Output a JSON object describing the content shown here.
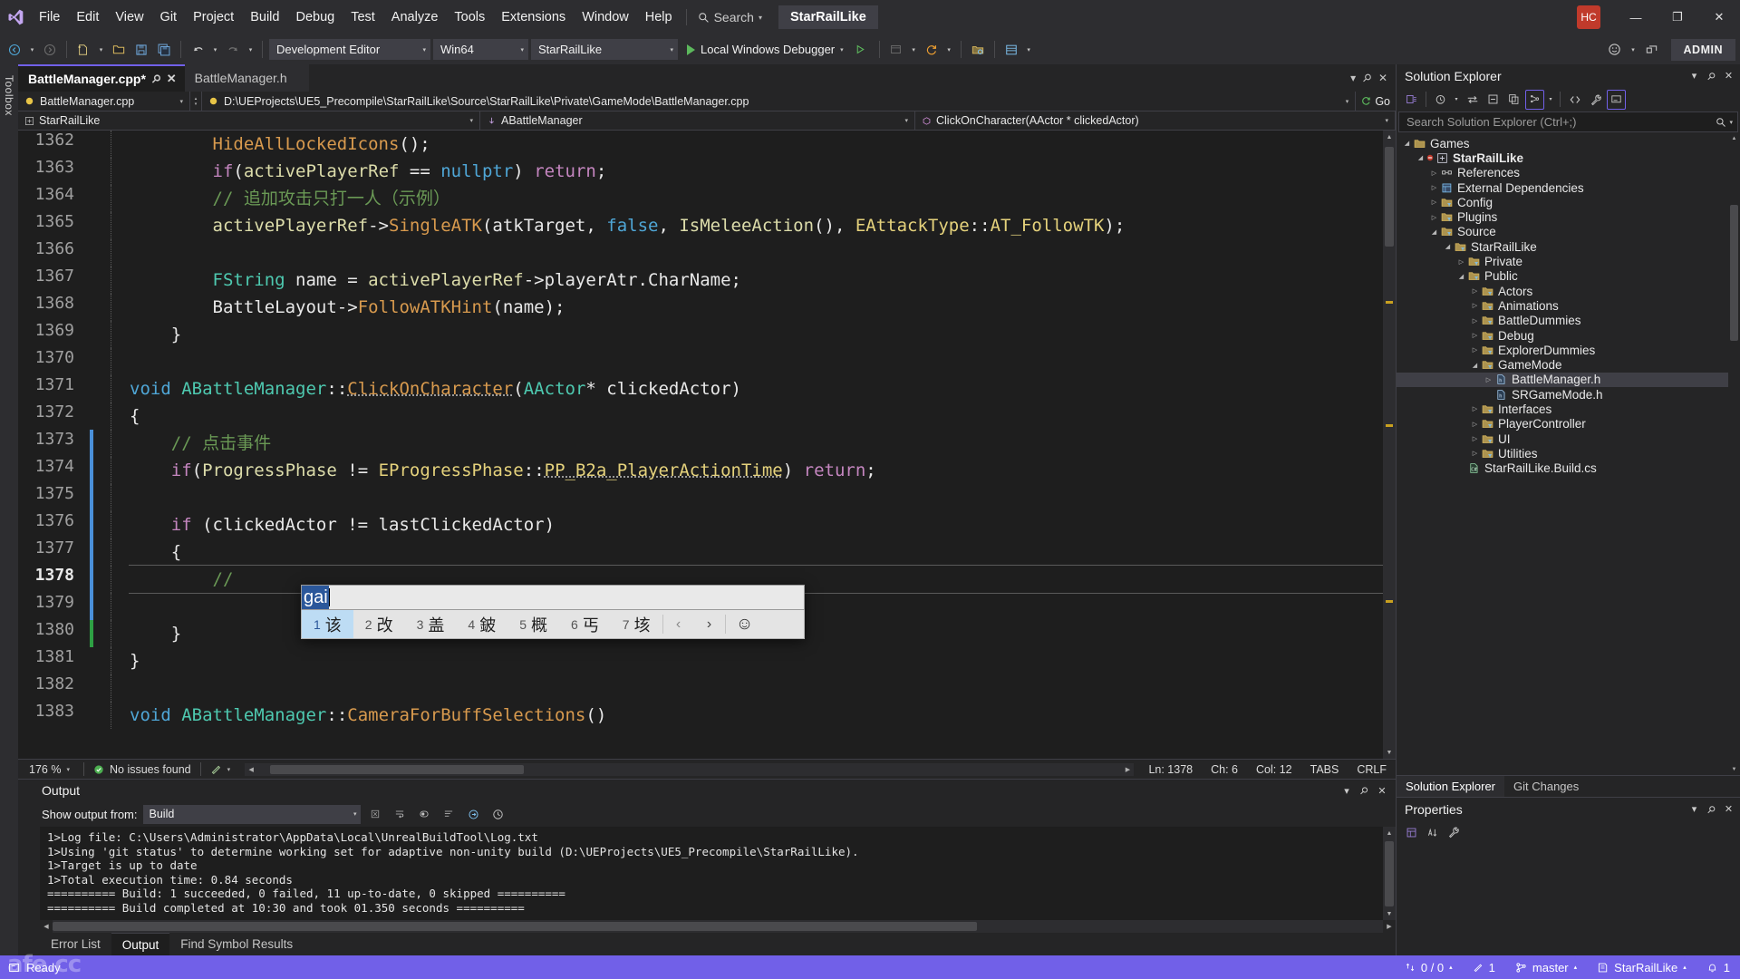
{
  "titlebar": {
    "logo_icon": "visual-studio-logo-icon",
    "menus": [
      "File",
      "Edit",
      "View",
      "Git",
      "Project",
      "Build",
      "Debug",
      "Test",
      "Analyze",
      "Tools",
      "Extensions",
      "Window",
      "Help"
    ],
    "search": {
      "label": "Search",
      "icon": "search-icon"
    },
    "solution_chip": "StarRailLike",
    "account_initials": "HC",
    "window_buttons": {
      "minimize": "—",
      "maximize": "❐",
      "close": "✕"
    }
  },
  "toolbar": {
    "back_icon": "navigate-back-icon",
    "forward_icon": "navigate-forward-icon",
    "new_item_icon": "new-item-icon",
    "open_icon": "open-file-icon",
    "save_icon": "save-icon",
    "save_all_icon": "save-all-icon",
    "undo_icon": "undo-icon",
    "redo_icon": "redo-icon",
    "config_combo": "Development Editor",
    "platform_combo": "Win64",
    "startup_combo": "StarRailLike",
    "run_label": "Local Windows Debugger",
    "run_icon": "play-icon",
    "attach_icon": "attach-process-icon",
    "layout_icon": "window-layout-icon",
    "refresh_icon": "hot-reload-icon",
    "folder_icon": "folder-icon",
    "panel_icon": "panel-icon",
    "feedback_icon": "feedback-icon",
    "live_share_icon": "live-share-icon",
    "admin_chip": "ADMIN"
  },
  "toolbox_strip": {
    "label": "Toolbox"
  },
  "editor": {
    "tabs": [
      {
        "label": "BattleManager.cpp*",
        "active": true,
        "pin_icon": "pin-icon",
        "close_icon": "close-icon"
      },
      {
        "label": "BattleManager.h",
        "active": false
      }
    ],
    "nav": {
      "file_combo": "BattleManager.cpp",
      "file_icon": "cpp-file-icon",
      "path": "D:\\UEProjects\\UE5_Precompile\\StarRailLike\\Source\\StarRailLike\\Private\\GameMode\\BattleManager.cpp",
      "path_icon": "cpp-file-icon",
      "go_label": "Go",
      "go_icon": "go-arrow-icon"
    },
    "breadcrumb": [
      {
        "label": "StarRailLike",
        "icon": "project-icon"
      },
      {
        "label": "ABattleManager",
        "icon": "class-icon"
      },
      {
        "label": "ClickOnCharacter(AActor * clickedActor)",
        "icon": "method-icon"
      }
    ],
    "lines": [
      {
        "no": "1362",
        "change": "",
        "tokens": [
          {
            "t": "        ",
            "c": "pl"
          },
          {
            "t": "HideAllLockedIcons",
            "c": "fn"
          },
          {
            "t": "();",
            "c": "pl"
          }
        ]
      },
      {
        "no": "1363",
        "change": "",
        "tokens": [
          {
            "t": "        ",
            "c": "pl"
          },
          {
            "t": "if",
            "c": "k"
          },
          {
            "t": "(",
            "c": "pl"
          },
          {
            "t": "activePlayerRef",
            "c": "id"
          },
          {
            "t": " == ",
            "c": "pl"
          },
          {
            "t": "nullptr",
            "c": "kb"
          },
          {
            "t": ") ",
            "c": "pl"
          },
          {
            "t": "return",
            "c": "k"
          },
          {
            "t": ";",
            "c": "pl"
          }
        ]
      },
      {
        "no": "1364",
        "change": "",
        "tokens": [
          {
            "t": "        ",
            "c": "pl"
          },
          {
            "t": "// 追加攻击只打一人（示例）",
            "c": "cm"
          }
        ]
      },
      {
        "no": "1365",
        "change": "",
        "tokens": [
          {
            "t": "        ",
            "c": "pl"
          },
          {
            "t": "activePlayerRef",
            "c": "id"
          },
          {
            "t": "->",
            "c": "pl"
          },
          {
            "t": "SingleATK",
            "c": "fn"
          },
          {
            "t": "(",
            "c": "pl"
          },
          {
            "t": "atkTarget",
            "c": "pl"
          },
          {
            "t": ", ",
            "c": "pl"
          },
          {
            "t": "false",
            "c": "kb"
          },
          {
            "t": ", ",
            "c": "pl"
          },
          {
            "t": "IsMeleeAction",
            "c": "id"
          },
          {
            "t": "(), ",
            "c": "pl"
          },
          {
            "t": "EAttackType",
            "c": "en"
          },
          {
            "t": "::",
            "c": "pl"
          },
          {
            "t": "AT_FollowTK",
            "c": "en"
          },
          {
            "t": ");",
            "c": "pl"
          }
        ]
      },
      {
        "no": "1366",
        "change": "",
        "tokens": [
          {
            "t": "",
            "c": "pl"
          }
        ]
      },
      {
        "no": "1367",
        "change": "",
        "tokens": [
          {
            "t": "        ",
            "c": "pl"
          },
          {
            "t": "FString",
            "c": "cls"
          },
          {
            "t": " name = ",
            "c": "pl"
          },
          {
            "t": "activePlayerRef",
            "c": "id"
          },
          {
            "t": "->",
            "c": "pl"
          },
          {
            "t": "playerAtr",
            "c": "pl"
          },
          {
            "t": ".",
            "c": "pl"
          },
          {
            "t": "CharName",
            "c": "pl"
          },
          {
            "t": ";",
            "c": "pl"
          }
        ]
      },
      {
        "no": "1368",
        "change": "",
        "tokens": [
          {
            "t": "        ",
            "c": "pl"
          },
          {
            "t": "BattleLayout",
            "c": "pl"
          },
          {
            "t": "->",
            "c": "pl"
          },
          {
            "t": "FollowATKHint",
            "c": "fn"
          },
          {
            "t": "(name);",
            "c": "pl"
          }
        ]
      },
      {
        "no": "1369",
        "change": "",
        "tokens": [
          {
            "t": "    }",
            "c": "pl"
          }
        ]
      },
      {
        "no": "1370",
        "change": "",
        "tokens": [
          {
            "t": "",
            "c": "pl"
          }
        ]
      },
      {
        "no": "1371",
        "change": "",
        "tokens": [
          {
            "t": "void",
            "c": "kb"
          },
          {
            "t": " ",
            "c": "pl"
          },
          {
            "t": "ABattleManager",
            "c": "cls"
          },
          {
            "t": "::",
            "c": "pl"
          },
          {
            "t": "ClickOnCharacter",
            "c": "fn-und"
          },
          {
            "t": "(",
            "c": "pl"
          },
          {
            "t": "AActor",
            "c": "cls"
          },
          {
            "t": "* clickedActor)",
            "c": "pl"
          }
        ]
      },
      {
        "no": "1372",
        "change": "",
        "tokens": [
          {
            "t": "{",
            "c": "pl"
          }
        ]
      },
      {
        "no": "1373",
        "change": "edit",
        "tokens": [
          {
            "t": "    ",
            "c": "pl"
          },
          {
            "t": "// 点击事件",
            "c": "cm"
          }
        ]
      },
      {
        "no": "1374",
        "change": "edit",
        "tokens": [
          {
            "t": "    ",
            "c": "pl"
          },
          {
            "t": "if",
            "c": "k"
          },
          {
            "t": "(",
            "c": "pl"
          },
          {
            "t": "ProgressPhase",
            "c": "id"
          },
          {
            "t": " != ",
            "c": "pl"
          },
          {
            "t": "EProgressPhase",
            "c": "en"
          },
          {
            "t": "::",
            "c": "pl"
          },
          {
            "t": "PP_B2a_PlayerActionTime",
            "c": "en-und"
          },
          {
            "t": ") ",
            "c": "pl"
          },
          {
            "t": "return",
            "c": "k"
          },
          {
            "t": ";",
            "c": "pl"
          }
        ]
      },
      {
        "no": "1375",
        "change": "edit",
        "tokens": [
          {
            "t": "",
            "c": "pl"
          }
        ]
      },
      {
        "no": "1376",
        "change": "edit",
        "tokens": [
          {
            "t": "    ",
            "c": "pl"
          },
          {
            "t": "if",
            "c": "k"
          },
          {
            "t": " (clickedActor != lastClickedActor)",
            "c": "pl"
          }
        ]
      },
      {
        "no": "1377",
        "change": "edit",
        "tokens": [
          {
            "t": "    {",
            "c": "pl"
          }
        ]
      },
      {
        "no": "1378",
        "change": "edit",
        "current": true,
        "tokens": [
          {
            "t": "        ",
            "c": "pl"
          },
          {
            "t": "//  ",
            "c": "cm"
          }
        ]
      },
      {
        "no": "1379",
        "change": "edit",
        "tokens": [
          {
            "t": "",
            "c": "pl"
          }
        ]
      },
      {
        "no": "1380",
        "change": "save",
        "tokens": [
          {
            "t": "    }",
            "c": "pl"
          }
        ]
      },
      {
        "no": "1381",
        "change": "",
        "tokens": [
          {
            "t": "}",
            "c": "pl"
          }
        ]
      },
      {
        "no": "1382",
        "change": "",
        "tokens": [
          {
            "t": "",
            "c": "pl"
          }
        ]
      },
      {
        "no": "1383",
        "change": "",
        "tokens": [
          {
            "t": "void",
            "c": "kb"
          },
          {
            "t": " ",
            "c": "pl"
          },
          {
            "t": "ABattleManager",
            "c": "cls"
          },
          {
            "t": "::",
            "c": "pl"
          },
          {
            "t": "CameraForBuffSelections",
            "c": "fn"
          },
          {
            "t": "()",
            "c": "pl"
          }
        ]
      }
    ],
    "status": {
      "zoom": "176 %",
      "issues": "No issues found",
      "issues_icon": "checkmark-circle-icon",
      "ln": "Ln: 1378",
      "ch": "Ch: 6",
      "col": "Col: 12",
      "tabs": "TABS",
      "eol": "CRLF"
    }
  },
  "ime": {
    "composition": "gai",
    "candidates": [
      {
        "num": "1",
        "char": "该",
        "selected": true
      },
      {
        "num": "2",
        "char": "改",
        "selected": false
      },
      {
        "num": "3",
        "char": "盖",
        "selected": false
      },
      {
        "num": "4",
        "char": "鈹",
        "selected": false
      },
      {
        "num": "5",
        "char": "概",
        "selected": false
      },
      {
        "num": "6",
        "char": "丐",
        "selected": false
      },
      {
        "num": "7",
        "char": "垓",
        "selected": false
      }
    ],
    "prev_icon": "chevron-left-icon",
    "next_icon": "chevron-right-icon",
    "emoji_icon": "emoji-icon"
  },
  "output": {
    "title": "Output",
    "show_from_label": "Show output from:",
    "show_from_value": "Build",
    "toolbar_icons": [
      "clear-all-icon",
      "word-wrap-icon",
      "toggle-icon",
      "find-icon",
      "go-to-icon",
      "history-icon"
    ],
    "controls": {
      "dropdown": "chevron-down-icon",
      "pin": "pin-icon",
      "close": "close-icon"
    },
    "lines": [
      "1>Log file: C:\\Users\\Administrator\\AppData\\Local\\UnrealBuildTool\\Log.txt",
      "1>Using 'git status' to determine working set for adaptive non-unity build (D:\\UEProjects\\UE5_Precompile\\StarRailLike).",
      "1>Target is up to date",
      "1>Total execution time: 0.84 seconds",
      "========== Build: 1 succeeded, 0 failed, 11 up-to-date, 0 skipped ==========",
      "========== Build completed at 10:30 and took 01.350 seconds =========="
    ],
    "tabs": [
      {
        "label": "Error List",
        "active": false
      },
      {
        "label": "Output",
        "active": true
      },
      {
        "label": "Find Symbol Results",
        "active": false
      }
    ]
  },
  "solution_explorer": {
    "title": "Solution Explorer",
    "controls": {
      "dropdown": "chevron-down-icon",
      "pin": "pin-icon",
      "close": "close-icon"
    },
    "toolbar_icons": [
      "solution-home-icon",
      "pending-changes-icon",
      "sync-with-active-icon",
      "collapse-all-icon",
      "copy-icon",
      "show-all-files-icon",
      "code-view-icon",
      "properties-wrench-icon",
      "preview-icon"
    ],
    "search_placeholder": "Search Solution Explorer (Ctrl+;)",
    "search_icon": "search-icon",
    "tree": [
      {
        "label": "Games",
        "indent": 0,
        "arrow": "open",
        "icon": "folder-icon",
        "bold": false,
        "selected": false
      },
      {
        "label": "StarRailLike",
        "indent": 1,
        "arrow": "open",
        "icon": "project-icon",
        "bold": true,
        "selected": false
      },
      {
        "label": "References",
        "indent": 2,
        "arrow": "closed",
        "icon": "references-icon",
        "bold": false,
        "selected": false
      },
      {
        "label": "External Dependencies",
        "indent": 2,
        "arrow": "closed",
        "icon": "dependencies-icon",
        "bold": false,
        "selected": false
      },
      {
        "label": "Config",
        "indent": 2,
        "arrow": "closed",
        "icon": "filter-folder-icon",
        "bold": false,
        "selected": false
      },
      {
        "label": "Plugins",
        "indent": 2,
        "arrow": "closed",
        "icon": "filter-folder-icon",
        "bold": false,
        "selected": false
      },
      {
        "label": "Source",
        "indent": 2,
        "arrow": "open",
        "icon": "filter-folder-icon",
        "bold": false,
        "selected": false
      },
      {
        "label": "StarRailLike",
        "indent": 3,
        "arrow": "open",
        "icon": "filter-folder-icon",
        "bold": false,
        "selected": false
      },
      {
        "label": "Private",
        "indent": 4,
        "arrow": "closed",
        "icon": "filter-folder-icon",
        "bold": false,
        "selected": false
      },
      {
        "label": "Public",
        "indent": 4,
        "arrow": "open",
        "icon": "filter-folder-icon",
        "bold": false,
        "selected": false
      },
      {
        "label": "Actors",
        "indent": 5,
        "arrow": "closed",
        "icon": "filter-folder-icon",
        "bold": false,
        "selected": false
      },
      {
        "label": "Animations",
        "indent": 5,
        "arrow": "closed",
        "icon": "filter-folder-icon",
        "bold": false,
        "selected": false
      },
      {
        "label": "BattleDummies",
        "indent": 5,
        "arrow": "closed",
        "icon": "filter-folder-icon",
        "bold": false,
        "selected": false
      },
      {
        "label": "Debug",
        "indent": 5,
        "arrow": "closed",
        "icon": "filter-folder-icon",
        "bold": false,
        "selected": false
      },
      {
        "label": "ExplorerDummies",
        "indent": 5,
        "arrow": "closed",
        "icon": "filter-folder-icon",
        "bold": false,
        "selected": false
      },
      {
        "label": "GameMode",
        "indent": 5,
        "arrow": "open",
        "icon": "filter-folder-icon",
        "bold": false,
        "selected": false
      },
      {
        "label": "BattleManager.h",
        "indent": 6,
        "arrow": "closed",
        "icon": "header-file-icon",
        "bold": false,
        "selected": true
      },
      {
        "label": "SRGameMode.h",
        "indent": 6,
        "arrow": "",
        "icon": "header-file-icon",
        "bold": false,
        "selected": false
      },
      {
        "label": "Interfaces",
        "indent": 5,
        "arrow": "closed",
        "icon": "filter-folder-icon",
        "bold": false,
        "selected": false
      },
      {
        "label": "PlayerController",
        "indent": 5,
        "arrow": "closed",
        "icon": "filter-folder-icon",
        "bold": false,
        "selected": false
      },
      {
        "label": "UI",
        "indent": 5,
        "arrow": "closed",
        "icon": "filter-folder-icon",
        "bold": false,
        "selected": false
      },
      {
        "label": "Utilities",
        "indent": 5,
        "arrow": "closed",
        "icon": "filter-folder-icon",
        "bold": false,
        "selected": false
      },
      {
        "label": "StarRailLike.Build.cs",
        "indent": 4,
        "arrow": "",
        "icon": "csharp-file-icon",
        "bold": false,
        "selected": false
      }
    ],
    "dock_tabs": [
      {
        "label": "Solution Explorer",
        "active": true
      },
      {
        "label": "Git Changes",
        "active": false
      }
    ]
  },
  "properties": {
    "title": "Properties",
    "controls": {
      "dropdown": "chevron-down-icon",
      "pin": "pin-icon",
      "close": "close-icon"
    },
    "toolbar_icons": [
      "categorized-icon",
      "alphabetical-icon",
      "property-pages-icon"
    ]
  },
  "statusbar": {
    "ready": "Ready",
    "ready_icon": "ready-icon",
    "changes": "0 / 0",
    "changes_icon": "source-control-icon",
    "outgoing_icon": "updown-arrow-icon",
    "pencil_count": "1",
    "pencil_icon": "pencil-icon",
    "branch": "master",
    "branch_icon": "branch-icon",
    "repo": "StarRailLike",
    "repo_icon": "repo-icon",
    "bell_icon": "bell-icon",
    "bell_count": "1",
    "accent": "#7160e8"
  },
  "watermark": "afe.cc"
}
